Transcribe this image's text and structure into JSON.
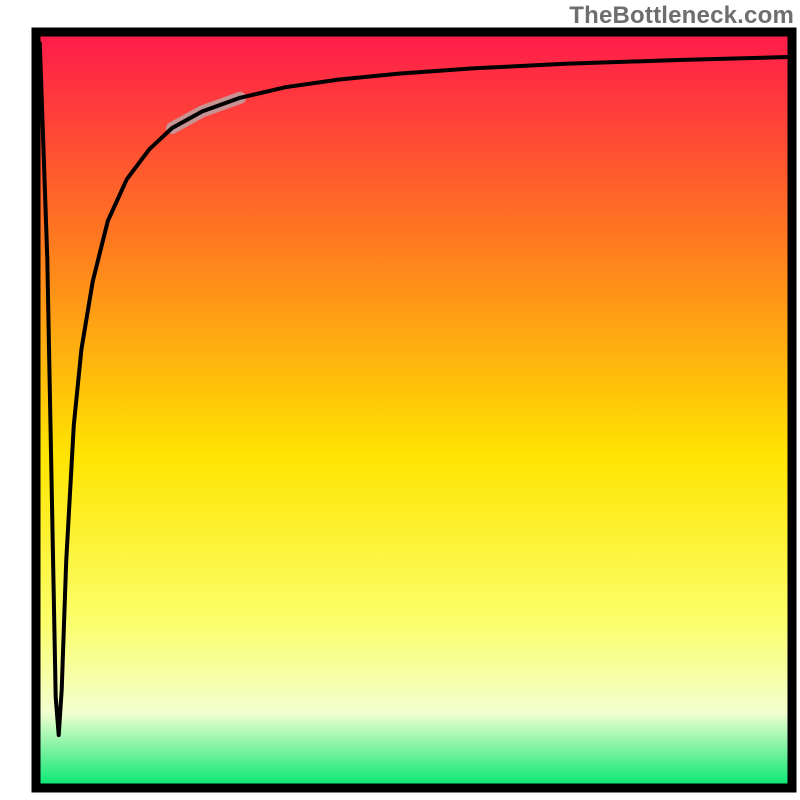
{
  "watermark": "TheBottleneck.com",
  "colors": {
    "gradient_top": "#ff1a4b",
    "gradient_mid_upper": "#ff7b1f",
    "gradient_mid": "#ffe400",
    "gradient_lower": "#fbff6a",
    "gradient_pale": "#f2ffd0",
    "gradient_bottom": "#00e670",
    "frame": "#000000",
    "curve": "#000000",
    "highlight": "#c79393"
  },
  "chart_data": {
    "type": "line",
    "title": "",
    "xlabel": "",
    "ylabel": "",
    "xlim": [
      0,
      100
    ],
    "ylim": [
      0,
      100
    ],
    "series": [
      {
        "name": "bottleneck-curve",
        "x": [
          0.5,
          1.5,
          2.6,
          3.0,
          3.4,
          4.0,
          5.0,
          6.0,
          7.5,
          9.5,
          12.0,
          15.0,
          18.0,
          22.0,
          27.0,
          33.0,
          40.0,
          48.0,
          58.0,
          70.0,
          85.0,
          100.0
        ],
        "y": [
          98.5,
          70.0,
          12.0,
          7.0,
          13.0,
          30.0,
          48.0,
          58.0,
          67.0,
          75.0,
          80.5,
          84.5,
          87.3,
          89.5,
          91.3,
          92.7,
          93.7,
          94.5,
          95.2,
          95.8,
          96.3,
          96.7
        ]
      }
    ],
    "annotations": [
      {
        "name": "highlight-segment",
        "x_range": [
          18.0,
          27.0
        ],
        "note": "thick pale-red stroke overlay on the rising part of the curve"
      }
    ],
    "background_gradient_stops": [
      {
        "offset": 0.0,
        "color": "#ff1a4b"
      },
      {
        "offset": 0.28,
        "color": "#ff7b1f"
      },
      {
        "offset": 0.56,
        "color": "#ffe400"
      },
      {
        "offset": 0.78,
        "color": "#fbff6a"
      },
      {
        "offset": 0.9,
        "color": "#f2ffd0"
      },
      {
        "offset": 1.0,
        "color": "#00e670"
      }
    ]
  }
}
